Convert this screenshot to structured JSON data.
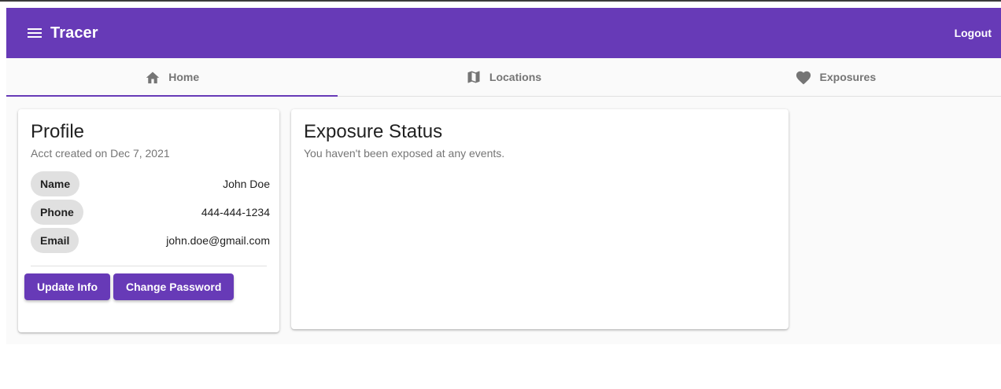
{
  "app": {
    "title": "Tracer",
    "logout_label": "Logout"
  },
  "tabs": [
    {
      "label": "Home",
      "icon": "home-icon",
      "active": true
    },
    {
      "label": "Locations",
      "icon": "map-icon",
      "active": false
    },
    {
      "label": "Exposures",
      "icon": "heart-icon",
      "active": false
    }
  ],
  "profile": {
    "title": "Profile",
    "subtitle": "Acct created on Dec 7, 2021",
    "fields": [
      {
        "label": "Name",
        "value": "John Doe"
      },
      {
        "label": "Phone",
        "value": "444-444-1234"
      },
      {
        "label": "Email",
        "value": "john.doe@gmail.com"
      }
    ],
    "update_button": "Update Info",
    "password_button": "Change Password"
  },
  "exposure": {
    "title": "Exposure Status",
    "message": "You haven't been exposed at any events."
  },
  "colors": {
    "primary": "#673ab7",
    "chip": "#e0e0e0",
    "background": "#fafafa"
  }
}
